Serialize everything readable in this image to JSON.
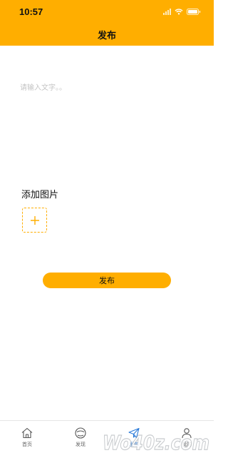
{
  "status_bar": {
    "time": "10:57",
    "icons": [
      "signal-icon",
      "wifi-icon",
      "battery-icon"
    ]
  },
  "nav": {
    "title": "发布"
  },
  "post_form": {
    "text_placeholder": "请输入文字。。",
    "text_value": "",
    "add_image_label": "添加图片",
    "add_image_icon": "plus-icon",
    "publish_label": "发布"
  },
  "tab_bar": {
    "active_index": 2,
    "tabs": [
      {
        "label": "首页",
        "icon": "home-icon"
      },
      {
        "label": "发现",
        "icon": "discover-icon"
      },
      {
        "label": "发布",
        "icon": "paper-plane-icon"
      },
      {
        "label": "我的",
        "icon": "profile-icon"
      }
    ]
  },
  "watermark": {
    "text": "Wo40z.com",
    "icon": "watermark-logo"
  },
  "colors": {
    "accent": "#FFAE00",
    "active_tab": "#2A7AD8",
    "placeholder": "#C4C4C4",
    "text": "#111111"
  }
}
